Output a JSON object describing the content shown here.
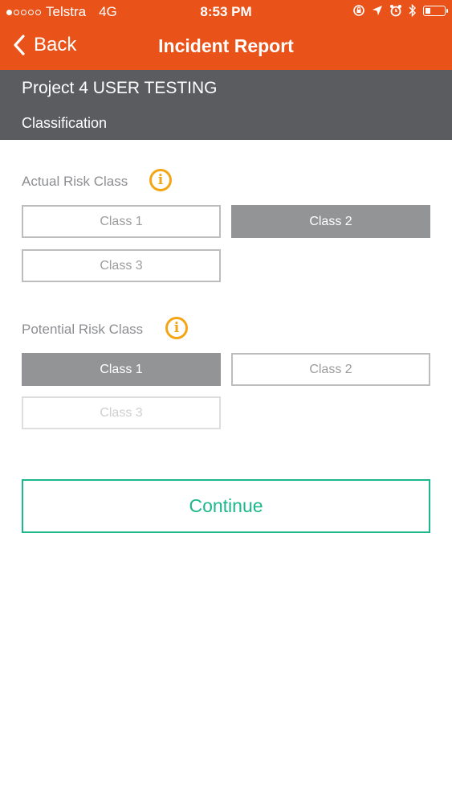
{
  "status_bar": {
    "carrier": "Telstra",
    "network": "4G",
    "time": "8:53 PM"
  },
  "nav": {
    "back_label": "Back",
    "title": "Incident Report"
  },
  "header": {
    "project": "Project 4 USER TESTING",
    "section": "Classification"
  },
  "actual_risk": {
    "label": "Actual Risk Class",
    "options": [
      "Class 1",
      "Class 2",
      "Class 3"
    ],
    "selected": "Class 2"
  },
  "potential_risk": {
    "label": "Potential Risk Class",
    "options": [
      "Class 1",
      "Class 2",
      "Class 3"
    ],
    "selected": "Class 1",
    "disabled": "Class 3"
  },
  "continue_label": "Continue",
  "colors": {
    "nav_orange": "#e9531a",
    "header_gray": "#5b5c60",
    "selected_gray": "#939496",
    "info_amber": "#f2a515",
    "continue_green": "#1ab88a"
  },
  "icons": {
    "info": "info-circle-icon",
    "back": "chevron-left-icon"
  }
}
